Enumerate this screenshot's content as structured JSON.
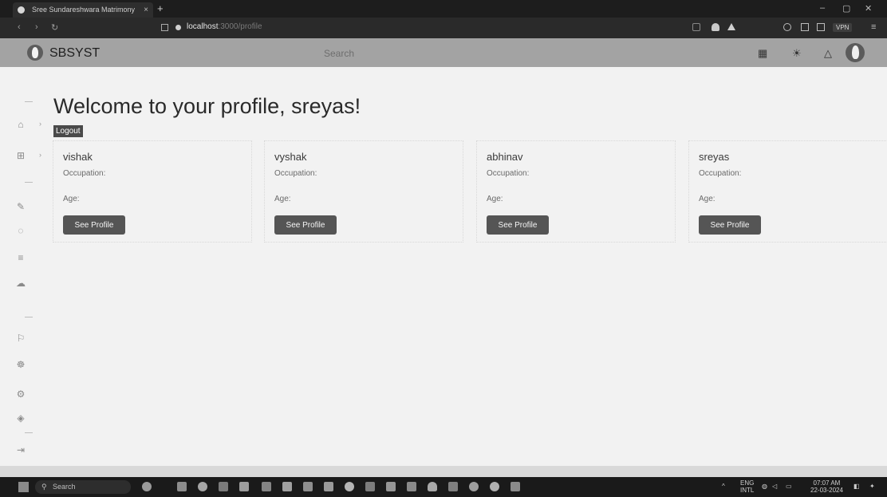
{
  "browser": {
    "tab_title": "Sree Sundareshwara Matrimony",
    "tab_close": "×",
    "new_tab": "+",
    "url_host": "localhost",
    "url_rest": ":3000/profile",
    "vpn_label": "VPN",
    "window_controls": [
      "–",
      "▢",
      "✕"
    ]
  },
  "app_header": {
    "brand": "SBSYST",
    "search_placeholder": "Search"
  },
  "main": {
    "welcome_title": "Welcome to your profile, sreyas!",
    "logout_label": "Logout"
  },
  "profiles": [
    {
      "name": "vishak",
      "occupation_label": "Occupation:",
      "age_label": "Age:",
      "button_label": "See Profile"
    },
    {
      "name": "vyshak",
      "occupation_label": "Occupation:",
      "age_label": "Age:",
      "button_label": "See Profile"
    },
    {
      "name": "abhinav",
      "occupation_label": "Occupation:",
      "age_label": "Age:",
      "button_label": "See Profile"
    },
    {
      "name": "sreyas",
      "occupation_label": "Occupation:",
      "age_label": "Age:",
      "button_label": "See Profile"
    }
  ],
  "taskbar": {
    "search_label": "Search",
    "lang_line1": "ENG",
    "lang_line2": "INTL",
    "time": "07:07 AM",
    "date": "22-03-2024"
  },
  "icons": {
    "sidebar": [
      "home-icon",
      "apps-icon",
      "magic-wand-icon",
      "loader-icon",
      "filter-icon",
      "cloud-icon",
      "flag-icon",
      "medal-icon",
      "settings-icon",
      "layers-icon",
      "logout-icon"
    ],
    "header": [
      "apps-grid-icon",
      "sun-icon",
      "bell-icon"
    ]
  },
  "colors": {
    "app_header_bg": "#a3a3a3",
    "button_bg": "#555555",
    "logout_bg": "#4a4a4a",
    "page_bg": "#f2f2f2"
  }
}
